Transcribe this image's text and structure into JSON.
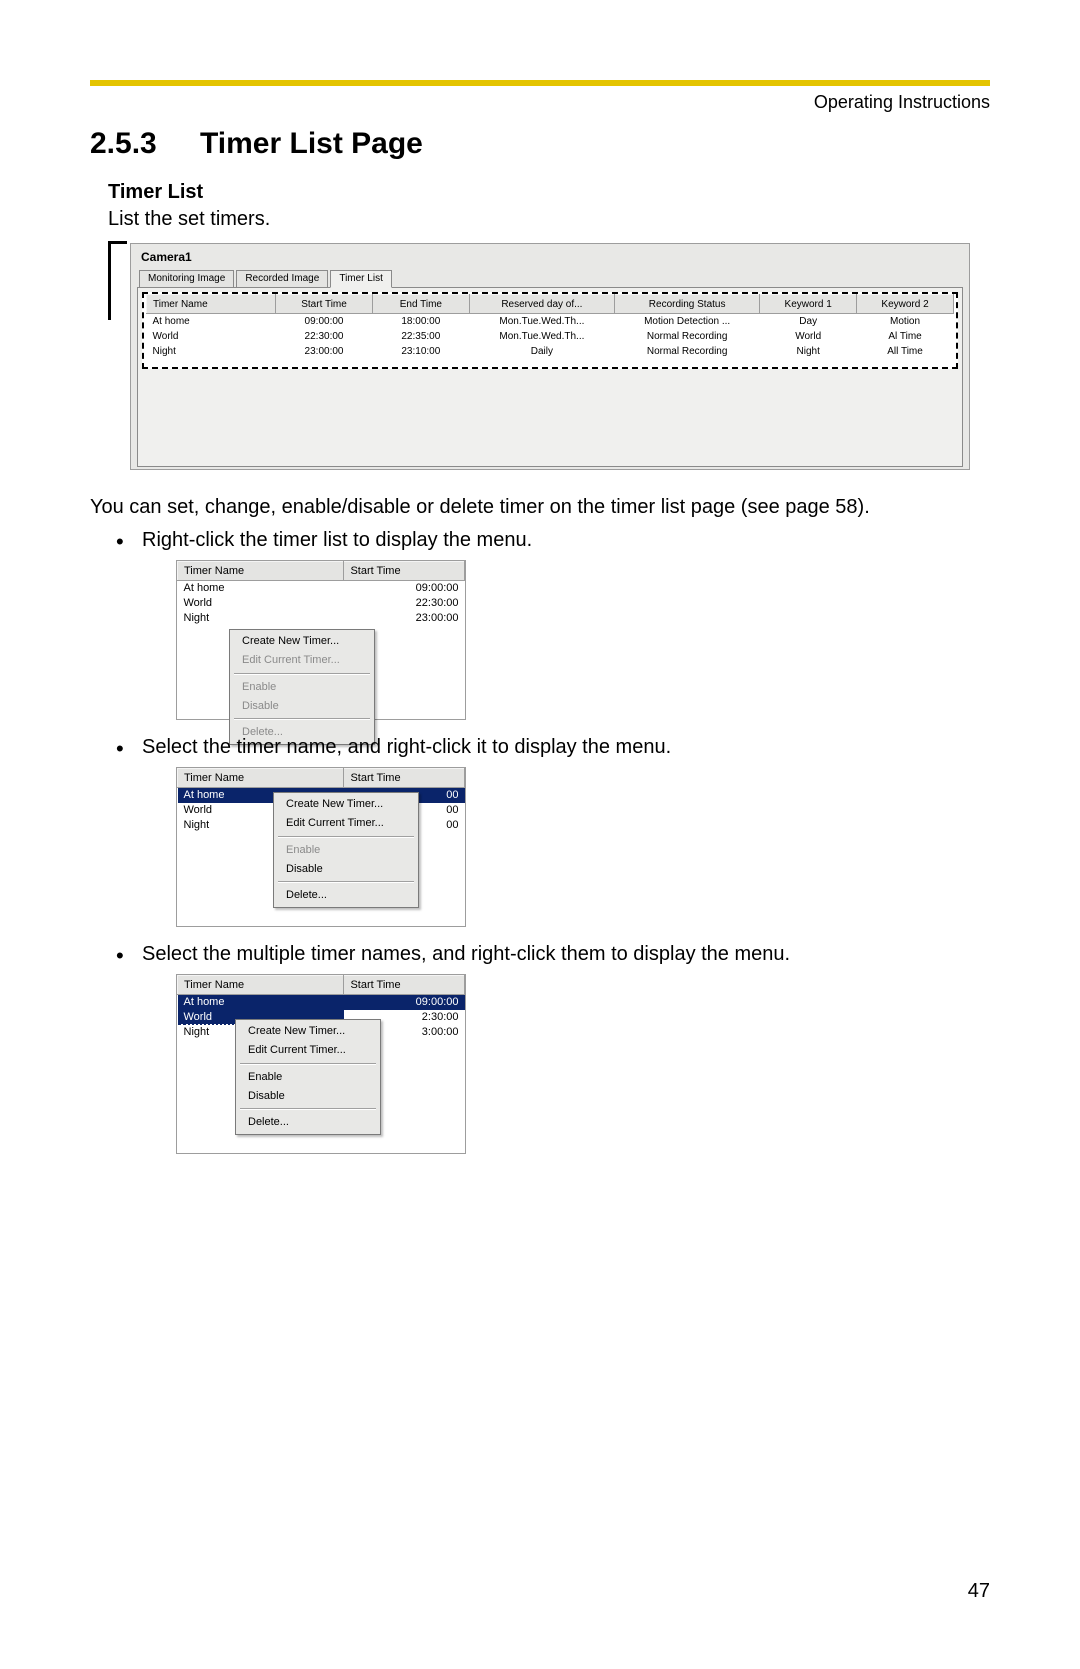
{
  "header": {
    "running": "Operating Instructions"
  },
  "section": {
    "number": "2.5.3",
    "title": "Timer List Page"
  },
  "sub": {
    "title": "Timer List",
    "desc": "List the set timers."
  },
  "fig1": {
    "window_title": "Camera1",
    "tabs": [
      "Monitoring Image",
      "Recorded Image",
      "Timer List"
    ],
    "active_tab": 2,
    "columns": [
      "Timer Name",
      "Start Time",
      "End Time",
      "Reserved day of...",
      "Recording Status",
      "Keyword 1",
      "Keyword 2"
    ],
    "rows": [
      {
        "cells": [
          "At home",
          "09:00:00",
          "18:00:00",
          "Mon.Tue.Wed.Th...",
          "Motion Detection ...",
          "Day",
          "Motion"
        ]
      },
      {
        "cells": [
          "World",
          "22:30:00",
          "22:35:00",
          "Mon.Tue.Wed.Th...",
          "Normal Recording",
          "World",
          "Al Time"
        ]
      },
      {
        "cells": [
          "Night",
          "23:00:00",
          "23:10:00",
          "Daily",
          "Normal Recording",
          "Night",
          "All Time"
        ]
      }
    ]
  },
  "para1": "You can set, change, enable/disable or delete timer on the timer list page (see page 58).",
  "bullets": {
    "b1": "Right-click the timer list to display the menu.",
    "b2": "Select the timer name, and right-click it to display the menu.",
    "b3": "Select the multiple timer names, and right-click them to display the menu."
  },
  "mini_columns": [
    "Timer Name",
    "Start Time"
  ],
  "mini_rows": [
    {
      "name": "At home",
      "time": "09:00:00"
    },
    {
      "name": "World",
      "time": "22:30:00"
    },
    {
      "name": "Night",
      "time": "23:00:00"
    }
  ],
  "mini_rows_b": [
    {
      "name": "At home",
      "time": "09:00:00",
      "sel": true,
      "time_cover": "00"
    },
    {
      "name": "World",
      "time": "22:30:00",
      "time_cover": "00"
    },
    {
      "name": "Night",
      "time": "23:00:00",
      "time_cover": "00"
    }
  ],
  "mini_rows_c": [
    {
      "name": "At home",
      "time": "09:00:00",
      "sel": true
    },
    {
      "name": "World",
      "time": "22:30:00",
      "sel": true,
      "time_cover": "2:30:00"
    },
    {
      "name": "Night",
      "time": "23:00:00",
      "time_cover": "3:00:00"
    }
  ],
  "menu": {
    "create": "Create New Timer...",
    "edit": "Edit Current Timer...",
    "enable": "Enable",
    "disable": "Disable",
    "delete": "Delete..."
  },
  "pagenum": "47"
}
